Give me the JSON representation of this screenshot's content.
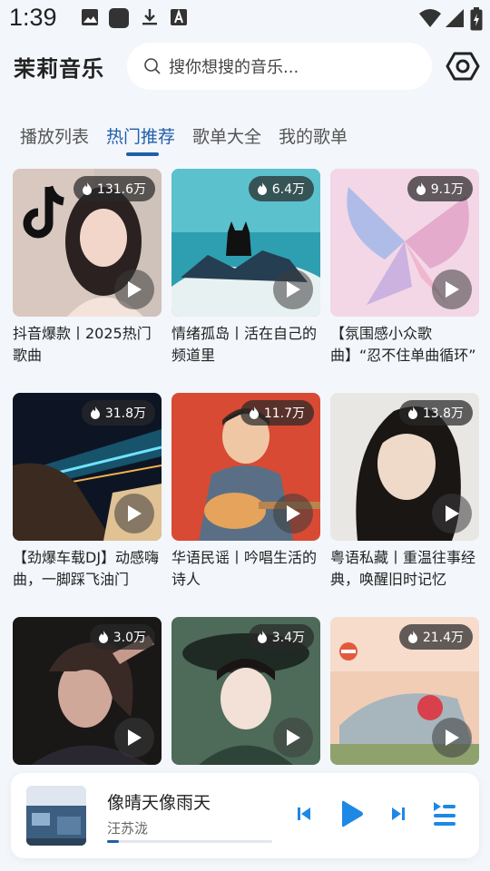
{
  "status_bar": {
    "time": "1:39"
  },
  "header": {
    "app_title": "茉莉音乐",
    "search_placeholder": "搜你想搜的音乐..."
  },
  "tabs": [
    {
      "label": "播放列表",
      "active": false
    },
    {
      "label": "热门推荐",
      "active": true
    },
    {
      "label": "歌单大全",
      "active": false
    },
    {
      "label": "我的歌单",
      "active": false
    }
  ],
  "playlists": [
    {
      "title": "抖音爆款丨2025热门歌曲",
      "plays": "131.6万"
    },
    {
      "title": "情绪孤岛丨活在自己的频道里",
      "plays": "6.4万"
    },
    {
      "title": "【氛围感小众歌曲】“忍不住单曲循环”",
      "plays": "9.1万"
    },
    {
      "title": "【劲爆车载DJ】动感嗨曲，一脚踩飞油门",
      "plays": "31.8万"
    },
    {
      "title": "华语民谣丨吟唱生活的诗人",
      "plays": "11.7万"
    },
    {
      "title": "粤语私藏丨重温往事经典，唤醒旧时记忆",
      "plays": "13.8万"
    },
    {
      "title": "",
      "plays": "3.0万"
    },
    {
      "title": "",
      "plays": "3.4万"
    },
    {
      "title": "",
      "plays": "21.4万"
    }
  ],
  "player": {
    "song": "像晴天像雨天",
    "artist": "汪苏泷",
    "progress": 0.07
  },
  "colors": {
    "accent": "#1f5ea8",
    "player_controls": "#1e88e5",
    "background": "#f3f6fb"
  },
  "icons": [
    "image-icon",
    "app-icon",
    "download-icon",
    "a-icon",
    "wifi-icon",
    "signal-icon",
    "battery-icon",
    "search-icon",
    "settings-icon",
    "fire-icon",
    "play-icon",
    "previous-icon",
    "play-button-icon",
    "next-icon",
    "playlist-icon"
  ]
}
